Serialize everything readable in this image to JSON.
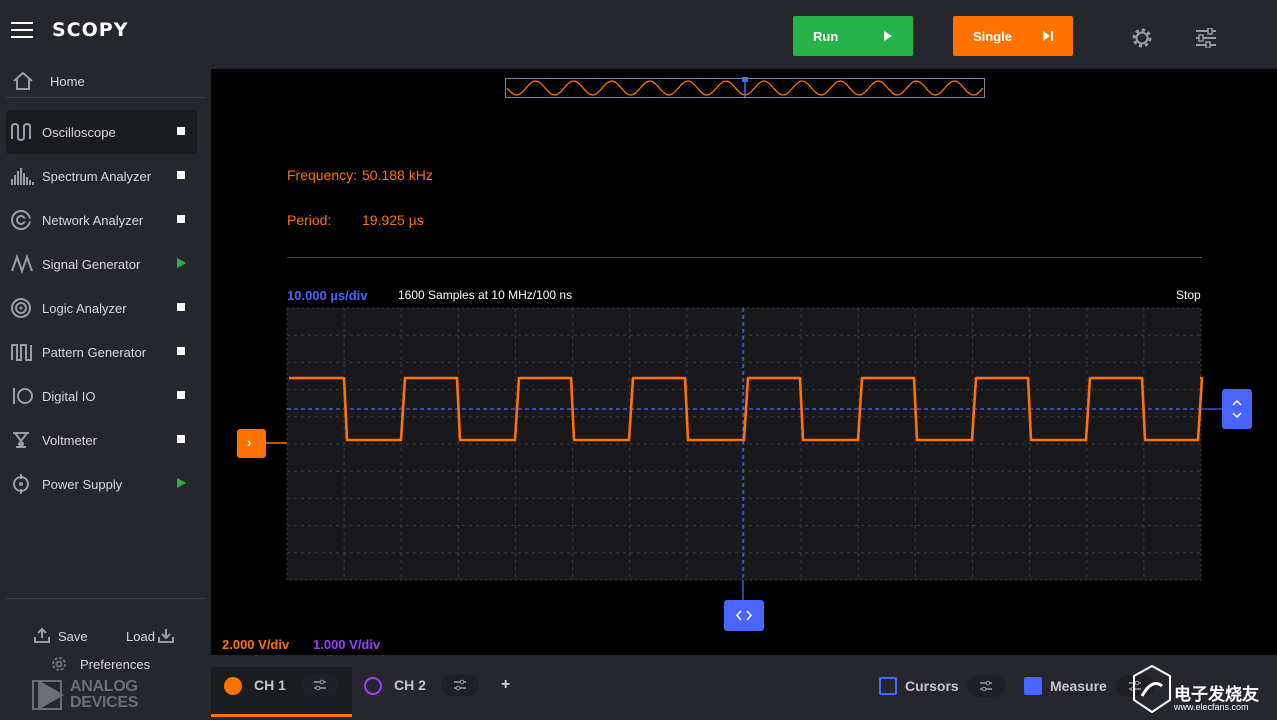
{
  "app": {
    "logo": "SCOPY"
  },
  "sidebar": {
    "home_label": "Home",
    "tools": [
      {
        "label": "Oscilloscope",
        "icon": "oscilloscope-icon",
        "state": "stop",
        "active": true
      },
      {
        "label": "Spectrum Analyzer",
        "icon": "spectrum-icon",
        "state": "stop"
      },
      {
        "label": "Network Analyzer",
        "icon": "network-icon",
        "state": "stop"
      },
      {
        "label": "Signal Generator",
        "icon": "signal-generator-icon",
        "state": "play"
      },
      {
        "label": "Logic Analyzer",
        "icon": "logic-analyzer-icon",
        "state": "stop"
      },
      {
        "label": "Pattern Generator",
        "icon": "pattern-generator-icon",
        "state": "stop"
      },
      {
        "label": "Digital IO",
        "icon": "digital-io-icon",
        "state": "stop"
      },
      {
        "label": "Voltmeter",
        "icon": "voltmeter-icon",
        "state": "stop"
      },
      {
        "label": "Power Supply",
        "icon": "power-supply-icon",
        "state": "play"
      }
    ],
    "save_label": "Save",
    "load_label": "Load",
    "preferences_label": "Preferences",
    "vendor_line1": "ANALOG",
    "vendor_line2": "DEVICES"
  },
  "toolbar": {
    "run_label": "Run",
    "single_label": "Single"
  },
  "measurements": {
    "frequency_label": "Frequency:",
    "frequency_value": "50.188 kHz",
    "period_label": "Period:",
    "period_value": "19.925 µs"
  },
  "plot": {
    "timebase": "10.000 µs/div",
    "samples_info": "1600 Samples at 10 MHz/100 ns",
    "status": "Stop",
    "ch1_scale": "2.000 V/div",
    "ch2_scale": "1.000 V/div"
  },
  "bottom": {
    "channels": [
      {
        "label": "CH 1",
        "color": "#ff7200"
      },
      {
        "label": "CH 2",
        "color": "#9b3cff"
      }
    ],
    "add_label": "+",
    "cursors_label": "Cursors",
    "measure_label": "Measure"
  },
  "watermark": {
    "line1": "电子发烧友",
    "line2": "www.elecfans.com"
  },
  "colors": {
    "accent": "#ff7200",
    "run": "#27b34a",
    "trigger": "#4a64ff",
    "ch2": "#9b3cff",
    "panel": "#25272d"
  }
}
